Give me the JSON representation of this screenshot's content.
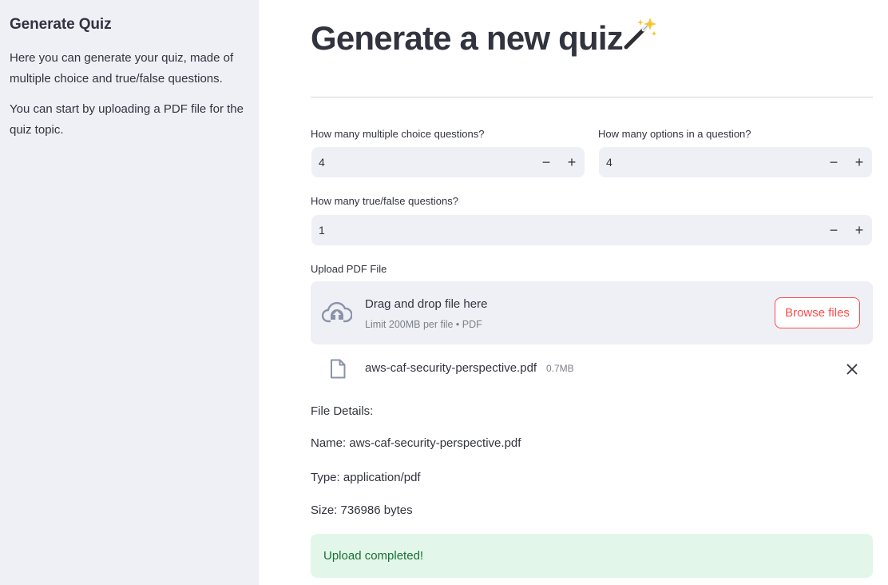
{
  "sidebar": {
    "title": "Generate Quiz",
    "paragraphs": [
      "Here you can generate your quiz, made of multiple choice and true/false questions.",
      "You can start by uploading a PDF file for the quiz topic."
    ]
  },
  "main": {
    "title": "Generate a new quiz",
    "title_icon": "magic-wand-icon",
    "inputs": {
      "mc_questions": {
        "label": "How many multiple choice questions?",
        "value": "4"
      },
      "options": {
        "label": "How many options in a question?",
        "value": "4"
      },
      "tf_questions": {
        "label": "How many true/false questions?",
        "value": "1"
      }
    },
    "step_minus": "−",
    "step_plus": "+",
    "upload": {
      "label": "Upload PDF File",
      "drop_title": "Drag and drop file here",
      "drop_subtitle": "Limit 200MB per file • PDF",
      "browse_label": "Browse files",
      "file": {
        "name": "aws-caf-security-perspective.pdf",
        "size": "0.7MB"
      }
    },
    "details": {
      "heading": "File Details:",
      "name": "Name: aws-caf-security-perspective.pdf",
      "type": "Type: application/pdf",
      "size": "Size: 736986 bytes"
    },
    "status": "Upload completed!"
  },
  "colors": {
    "accent": "#ff4b4b",
    "sidebar_bg": "#eef0f5",
    "success_bg": "#e3f6ea",
    "success_text": "#177233"
  }
}
